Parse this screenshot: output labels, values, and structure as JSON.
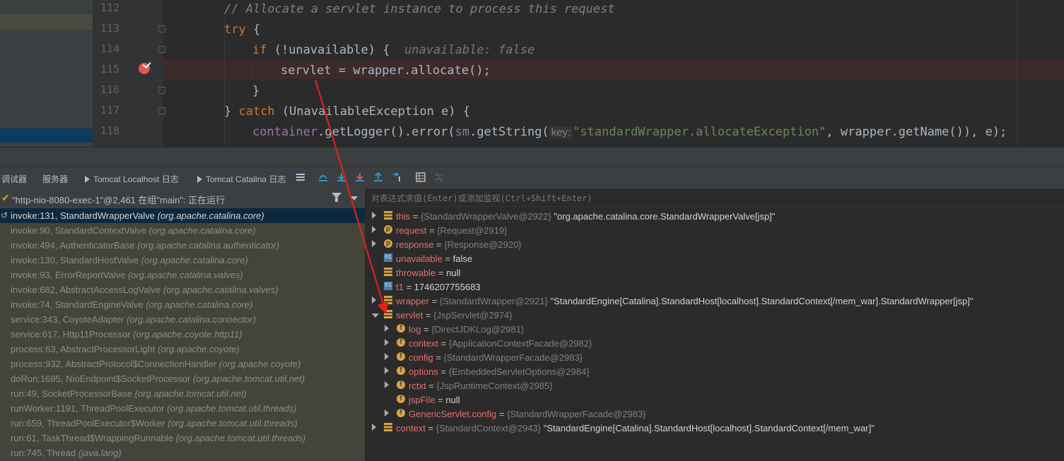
{
  "editor": {
    "line_numbers": [
      "112",
      "113",
      "114",
      "115",
      "116",
      "117",
      "118"
    ],
    "lines": [
      {
        "comment": "// Allocate a servlet instance to process this request"
      },
      {
        "kw1": "try",
        "rest": " {"
      },
      {
        "kw1": "if",
        "rest": " (!unavailable) {",
        "hint": "unavailable: false"
      },
      {
        "text": "servlet = wrapper.allocate();"
      },
      {
        "rest": "}"
      },
      {
        "pre": "} ",
        "kw1": "catch",
        "rest": " (UnavailableException e) {"
      },
      {
        "field1": "container",
        "mid1": ".getLogger().error(",
        "field2": "sm",
        "mid2": ".getString(",
        "param_hint": "key:",
        "string": "\"standardWrapper.allocateException\"",
        "mid3": ", wrapper.getName()), e);"
      }
    ]
  },
  "toolbar": {
    "tabs": [
      "调试器",
      "服务器",
      "Tomcat Localhost 日志",
      "Tomcat Catalina 日志"
    ]
  },
  "thread": {
    "label": "\"http-nio-8080-exec-1\"@2,461 在组\"main\": 正在运行"
  },
  "frames": [
    {
      "method": "invoke:131, StandardWrapperValve",
      "pkg": "(org.apache.catalina.core)"
    },
    {
      "method": "invoke:90, StandardContextValve",
      "pkg": "(org.apache.catalina.core)"
    },
    {
      "method": "invoke:494, AuthenticatorBase",
      "pkg": "(org.apache.catalina.authenticator)"
    },
    {
      "method": "invoke:130, StandardHostValve",
      "pkg": "(org.apache.catalina.core)"
    },
    {
      "method": "invoke:93, ErrorReportValve",
      "pkg": "(org.apache.catalina.valves)"
    },
    {
      "method": "invoke:682, AbstractAccessLogValve",
      "pkg": "(org.apache.catalina.valves)"
    },
    {
      "method": "invoke:74, StandardEngineValve",
      "pkg": "(org.apache.catalina.core)"
    },
    {
      "method": "service:343, CoyoteAdapter",
      "pkg": "(org.apache.catalina.connector)"
    },
    {
      "method": "service:617, Http11Processor",
      "pkg": "(org.apache.coyote.http11)"
    },
    {
      "method": "process:63, AbstractProcessorLight",
      "pkg": "(org.apache.coyote)"
    },
    {
      "method": "process:932, AbstractProtocol$ConnectionHandler",
      "pkg": "(org.apache.coyote)"
    },
    {
      "method": "doRun:1695, NioEndpoint$SocketProcessor",
      "pkg": "(org.apache.tomcat.util.net)"
    },
    {
      "method": "run:49, SocketProcessorBase",
      "pkg": "(org.apache.tomcat.util.net)"
    },
    {
      "method": "runWorker:1191, ThreadPoolExecutor",
      "pkg": "(org.apache.tomcat.util.threads)"
    },
    {
      "method": "run:659, ThreadPoolExecutor$Worker",
      "pkg": "(org.apache.tomcat.util.threads)"
    },
    {
      "method": "run:61, TaskThread$WrappingRunnable",
      "pkg": "(org.apache.tomcat.util.threads)"
    },
    {
      "method": "run:745, Thread",
      "pkg": "(java.lang)"
    }
  ],
  "eval": {
    "placeholder": "对表达式求值(Enter)或添加监视(Ctrl+Shift+Enter)"
  },
  "variables": [
    {
      "name": "this",
      "obj": "{StandardWrapperValve@2922}",
      "value": "\"org.apache.catalina.core.StandardWrapperValve[jsp]\"",
      "icon": "list",
      "expand": "closed",
      "indent": 0
    },
    {
      "name": "request",
      "obj": "{Request@2919}",
      "value": "",
      "icon": "p",
      "expand": "closed",
      "indent": 0
    },
    {
      "name": "response",
      "obj": "{Response@2920}",
      "value": "",
      "icon": "p",
      "expand": "closed",
      "indent": 0
    },
    {
      "name": "unavailable",
      "obj": "",
      "value": "false",
      "icon": "01",
      "expand": "none",
      "indent": 0
    },
    {
      "name": "throwable",
      "obj": "",
      "value": "null",
      "icon": "list",
      "expand": "none",
      "indent": 0
    },
    {
      "name": "t1",
      "obj": "",
      "value": "1746207755683",
      "icon": "01",
      "expand": "none",
      "indent": 0
    },
    {
      "name": "wrapper",
      "obj": "{StandardWrapper@2921}",
      "value": "\"StandardEngine[Catalina].StandardHost[localhost].StandardContext[/mem_war].StandardWrapper[jsp]\"",
      "icon": "list",
      "expand": "closed",
      "indent": 0
    },
    {
      "name": "servlet",
      "obj": "{JspServlet@2974}",
      "value": "",
      "icon": "list",
      "expand": "open",
      "indent": 0
    },
    {
      "name": "log",
      "obj": "{DirectJDKLog@2981}",
      "value": "",
      "icon": "f",
      "expand": "closed",
      "indent": 1
    },
    {
      "name": "context",
      "obj": "{ApplicationContextFacade@2982}",
      "value": "",
      "icon": "f",
      "expand": "closed",
      "indent": 1
    },
    {
      "name": "config",
      "obj": "{StandardWrapperFacade@2983}",
      "value": "",
      "icon": "f",
      "expand": "closed",
      "indent": 1
    },
    {
      "name": "options",
      "obj": "{EmbeddedServletOptions@2984}",
      "value": "",
      "icon": "f",
      "expand": "closed",
      "indent": 1
    },
    {
      "name": "rctxt",
      "obj": "{JspRuntimeContext@2985}",
      "value": "",
      "icon": "f",
      "expand": "closed",
      "indent": 1
    },
    {
      "name": "jspFile",
      "obj": "",
      "value": "null",
      "icon": "f",
      "expand": "none",
      "indent": 1
    },
    {
      "name": "GenericServlet.config",
      "obj": "{StandardWrapperFacade@2983}",
      "value": "",
      "icon": "f",
      "expand": "closed",
      "indent": 1
    },
    {
      "name": "context",
      "obj": "{StandardContext@2943}",
      "value": "\"StandardEngine[Catalina].StandardHost[localhost].StandardContext[/mem_war]\"",
      "icon": "list",
      "expand": "closed",
      "indent": 0
    }
  ],
  "colors": {
    "annotation_arrow": "#e8211a",
    "breakpoint": "#e05555"
  }
}
